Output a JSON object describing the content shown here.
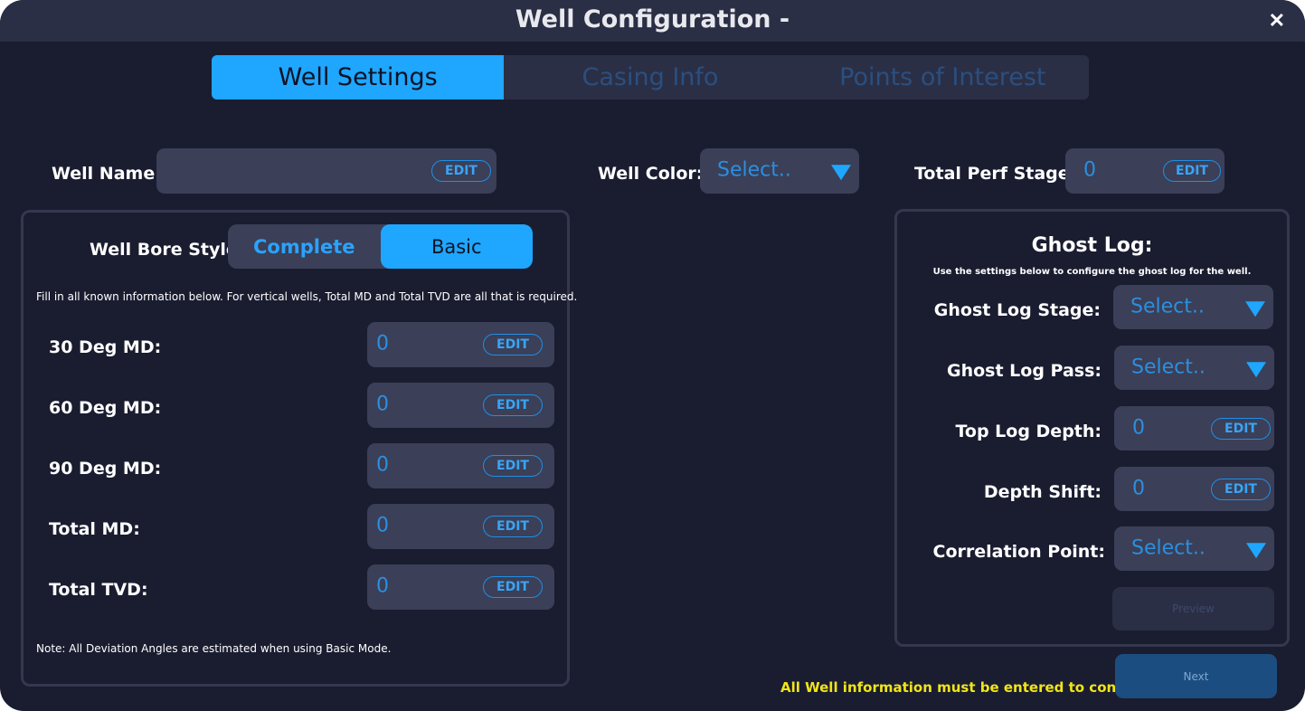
{
  "window": {
    "title": "Well Configuration -",
    "close_glyph": "✕"
  },
  "tabs": [
    {
      "label": "Well Settings",
      "active": true
    },
    {
      "label": "Casing Info",
      "active": false
    },
    {
      "label": "Points of Interest",
      "active": false
    }
  ],
  "top_row": {
    "well_name": {
      "label": "Well Name:",
      "value": "",
      "edit_label": "EDIT"
    },
    "well_color": {
      "label": "Well Color:",
      "value": "Select.."
    },
    "total_perf_stages": {
      "label": "Total Perf Stages:",
      "value": "0",
      "edit_label": "EDIT"
    }
  },
  "left_panel": {
    "bore_style_label": "Well Bore Style:",
    "bore_style_options": [
      "Complete",
      "Basic"
    ],
    "bore_style_selected": "Basic",
    "instructions": "Fill in all known information below. For vertical wells, Total MD and Total TVD are all that is required.",
    "fields": [
      {
        "label": "30 Deg MD:",
        "value": "0",
        "edit_label": "EDIT"
      },
      {
        "label": "60 Deg MD:",
        "value": "0",
        "edit_label": "EDIT"
      },
      {
        "label": "90 Deg MD:",
        "value": "0",
        "edit_label": "EDIT"
      },
      {
        "label": "Total MD:",
        "value": "0",
        "edit_label": "EDIT"
      },
      {
        "label": "Total TVD:",
        "value": "0",
        "edit_label": "EDIT"
      }
    ],
    "note": "Note: All Deviation Angles are estimated when using Basic Mode."
  },
  "ghost_log": {
    "title": "Ghost Log:",
    "subtitle": "Use the settings below to configure the ghost log for the well.",
    "stage": {
      "label": "Ghost Log Stage:",
      "value": "Select.."
    },
    "pass": {
      "label": "Ghost Log Pass:",
      "value": "Select.."
    },
    "top_log_depth": {
      "label": "Top Log Depth:",
      "value": "0",
      "edit_label": "EDIT"
    },
    "depth_shift": {
      "label": "Depth Shift:",
      "value": "0",
      "edit_label": "EDIT"
    },
    "correlation_point": {
      "label": "Correlation Point:",
      "value": "Select.."
    },
    "preview_label": "Preview"
  },
  "footer": {
    "warning": "All Well information must be entered to continue",
    "next_label": "Next"
  },
  "colors": {
    "background": "#1a1d30",
    "titlebar": "#2b2f45",
    "accent": "#1fa6ff",
    "field_bg": "#3b3f57",
    "warning": "#f1e51a"
  }
}
